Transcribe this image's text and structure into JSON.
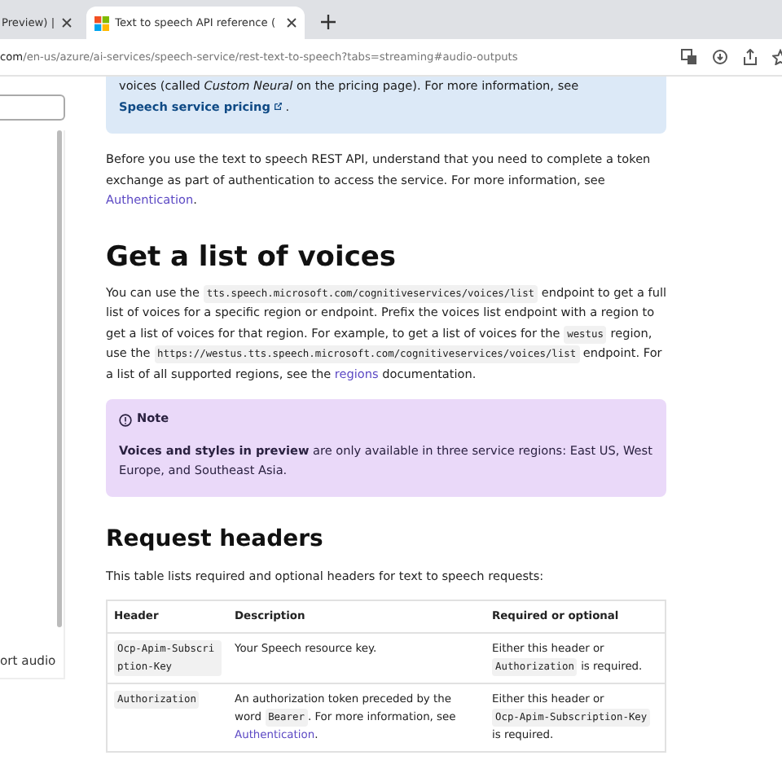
{
  "browser": {
    "tabs": [
      {
        "title": "Preview) |",
        "selected": false
      },
      {
        "title": "Text to speech API reference (",
        "selected": true
      }
    ],
    "url_host": "com",
    "url_path": "/en-us/azure/ai-services/speech-service/rest-text-to-speech?tabs=streaming#audio-outputs"
  },
  "sidebar": {
    "item": "ort audio"
  },
  "callout": {
    "segments": [
      {
        "kind": "text",
        "text": "voices (called "
      },
      {
        "kind": "italic",
        "text": "Custom Neural"
      },
      {
        "kind": "text",
        "text": " on the pricing page). For more information, see "
      },
      {
        "kind": "link",
        "text": "Speech service pricing"
      },
      {
        "kind": "text",
        "text": " ."
      }
    ]
  },
  "intro": [
    {
      "kind": "text",
      "text": "Before you use the text to speech REST API, understand that you need to complete a token exchange as part of authentication to access the service. For more information, see "
    },
    {
      "kind": "link",
      "text": "Authentication"
    },
    {
      "kind": "text",
      "text": "."
    }
  ],
  "section_title": "Get a list of voices",
  "section_body": [
    {
      "kind": "text",
      "text": "You can use the "
    },
    {
      "kind": "code",
      "text": "tts.speech.microsoft.com/cognitiveservices/voices/list"
    },
    {
      "kind": "text",
      "text": " endpoint to get a full list of voices for a specific region or endpoint. Prefix the voices list endpoint with a region to get a list of voices for that region. For example, to get a list of voices for the "
    },
    {
      "kind": "code",
      "text": "westus"
    },
    {
      "kind": "text",
      "text": " region, use the "
    },
    {
      "kind": "code",
      "text": "https://westus.tts.speech.microsoft.com/cognitiveservices/voices/list"
    },
    {
      "kind": "text",
      "text": " endpoint. For a list of all supported regions, see the "
    },
    {
      "kind": "link",
      "text": "regions"
    },
    {
      "kind": "text",
      "text": " documentation."
    }
  ],
  "note": {
    "title": "Note",
    "segments": [
      {
        "kind": "bold",
        "text": "Voices and styles in preview"
      },
      {
        "kind": "text",
        "text": " are only available in three service regions: East US, West Europe, and Southeast Asia."
      }
    ]
  },
  "headers_title": "Request headers",
  "headers_intro": "This table lists required and optional headers for text to speech requests:",
  "table": {
    "columns": [
      "Header",
      "Description",
      "Required or optional"
    ],
    "rows": [
      [
        [
          {
            "kind": "code",
            "text": "Ocp-Apim-Subscription-Key"
          }
        ],
        [
          {
            "kind": "text",
            "text": "Your Speech resource key."
          }
        ],
        [
          {
            "kind": "text",
            "text": "Either this header or "
          },
          {
            "kind": "code",
            "text": "Authorization"
          },
          {
            "kind": "text",
            "text": " is required."
          }
        ]
      ],
      [
        [
          {
            "kind": "code",
            "text": "Authorization"
          }
        ],
        [
          {
            "kind": "text",
            "text": "An authorization token preceded by the word "
          },
          {
            "kind": "code",
            "text": "Bearer"
          },
          {
            "kind": "text",
            "text": ". For more information, see "
          },
          {
            "kind": "link",
            "text": "Authentication"
          },
          {
            "kind": "text",
            "text": "."
          }
        ],
        [
          {
            "kind": "text",
            "text": "Either this header or "
          },
          {
            "kind": "code",
            "text": "Ocp-Apim-Subscription-Key"
          },
          {
            "kind": "text",
            "text": " is required."
          }
        ]
      ]
    ]
  }
}
